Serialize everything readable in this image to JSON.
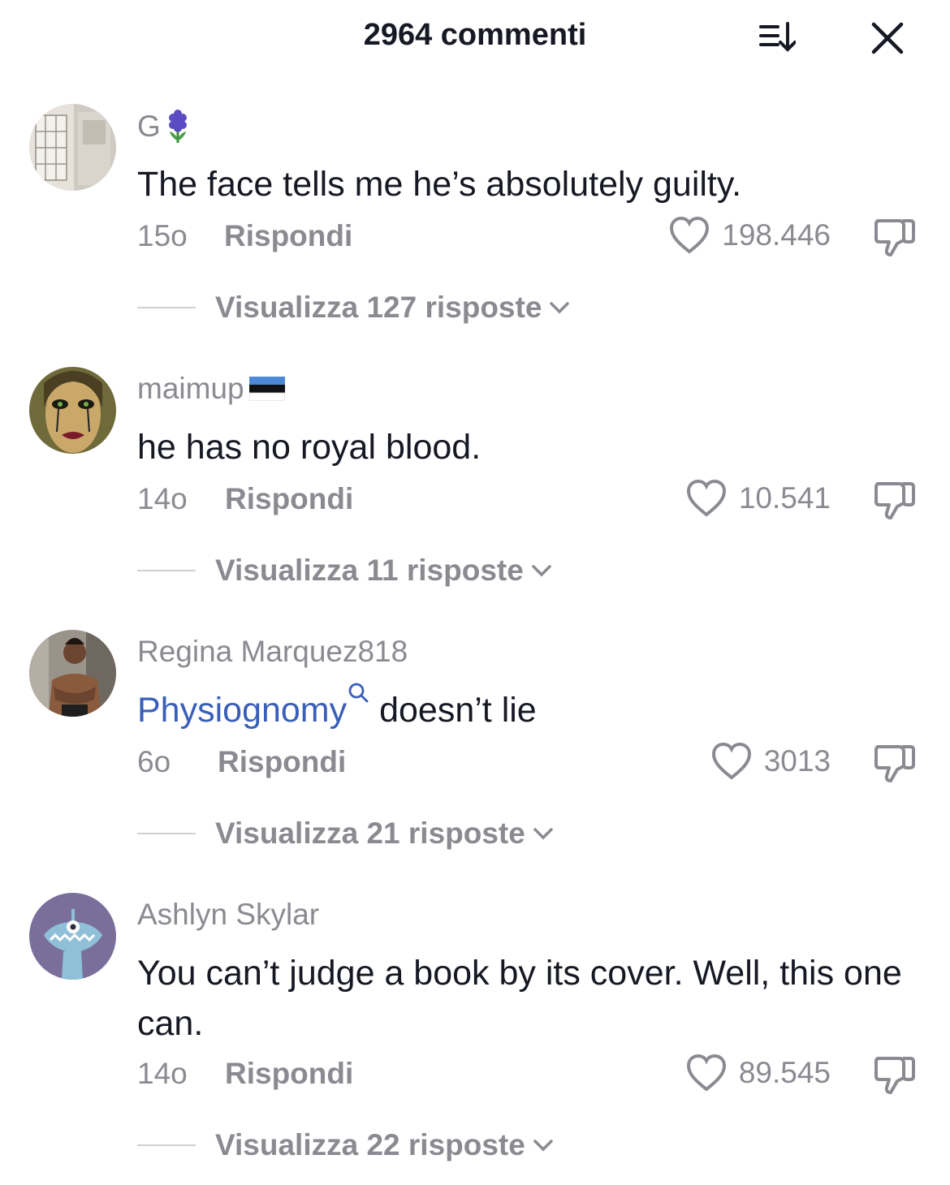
{
  "header": {
    "title": "2964 commenti",
    "sort_icon": "sort-icon",
    "close_icon": "close-icon"
  },
  "comments": [
    {
      "username": "G",
      "username_emoji": "hyacinth",
      "text": "The face tells me he’s absolutely guilty.",
      "time": "15o",
      "reply_label": "Rispondi",
      "likes": "198.446",
      "view_replies": "Visualizza 127 risposte"
    },
    {
      "username": "maimup",
      "username_emoji": "flag-estonia",
      "text": "he has no royal blood.",
      "time": "14o",
      "reply_label": "Rispondi",
      "likes": "10.541",
      "view_replies": "Visualizza 11 risposte"
    },
    {
      "username": "Regina Marquez818",
      "text_link": "Physiognomy",
      "text_rest": " doesn’t lie",
      "time": "6o",
      "reply_label": "Rispondi",
      "likes": "3013",
      "view_replies": "Visualizza 21 risposte"
    },
    {
      "username": "Ashlyn Skylar",
      "text": "You can’t judge a book by its cover. Well, this one can.",
      "time": "14o",
      "reply_label": "Rispondi",
      "likes": "89.545",
      "view_replies": "Visualizza 22 risposte"
    }
  ],
  "colors": {
    "muted": "#8a8b91",
    "text": "#161823",
    "hashtag": "#3a5fb8",
    "avatar4_bg": "#7a6f9a"
  }
}
